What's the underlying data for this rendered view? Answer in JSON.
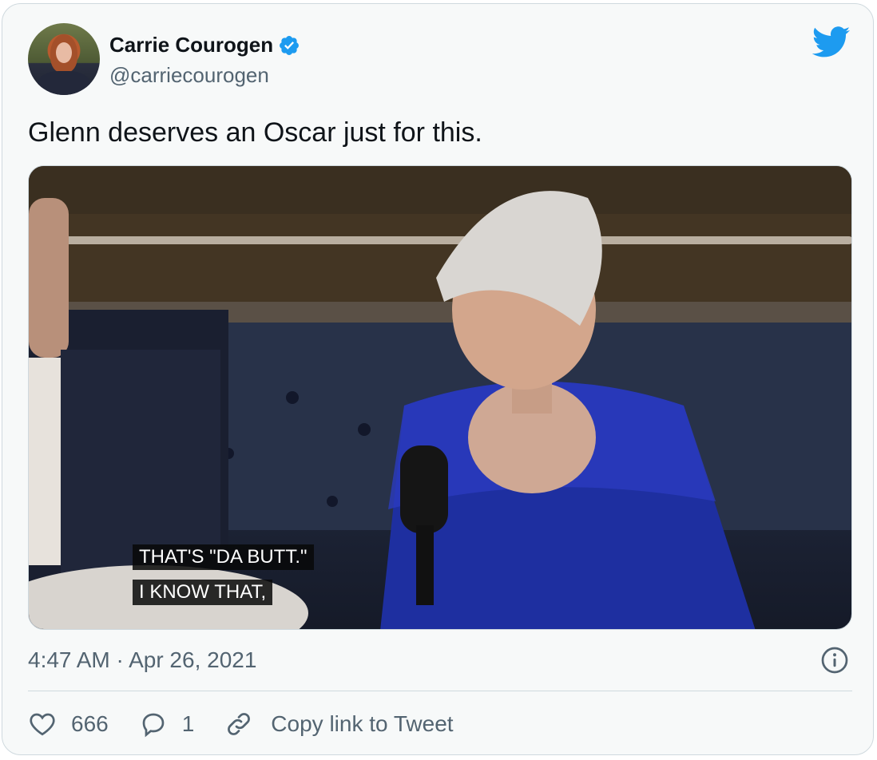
{
  "tweet": {
    "display_name": "Carrie Courogen",
    "handle": "@carriecourogen",
    "text": "Glenn deserves an Oscar just for this.",
    "timestamp": "4:47 AM · Apr 26, 2021",
    "verified": true
  },
  "media": {
    "caption_line1": "THAT'S \"DA BUTT.\"",
    "caption_line2": "I KNOW THAT,"
  },
  "actions": {
    "likes": "666",
    "replies": "1",
    "copy_link_label": "Copy link to Tweet"
  },
  "icons": {
    "logo": "twitter-bird-icon",
    "verified": "verified-badge-icon",
    "info": "info-icon",
    "like": "heart-icon",
    "reply": "reply-bubble-icon",
    "link": "link-icon"
  },
  "colors": {
    "brand": "#1d9bf0",
    "secondary_text": "#536471",
    "border": "#cfd9de"
  }
}
